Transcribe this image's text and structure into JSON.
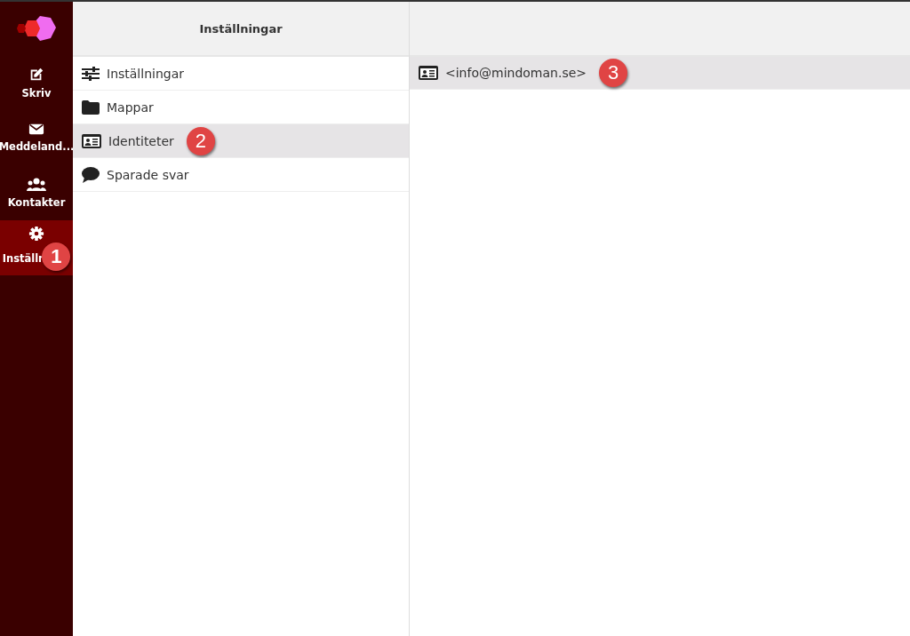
{
  "nav": [
    {
      "label": "Skriv",
      "selected": false
    },
    {
      "label": "Meddeland...",
      "selected": false
    },
    {
      "label": "Kontakter",
      "selected": false
    },
    {
      "label": "Inställn",
      "selected": true,
      "callout": "1"
    }
  ],
  "settings_panel": {
    "title": "Inställningar",
    "items": [
      {
        "label": "Inställningar",
        "selected": false
      },
      {
        "label": "Mappar",
        "selected": false
      },
      {
        "label": "Identiteter",
        "selected": true,
        "callout": "2"
      },
      {
        "label": "Sparade svar",
        "selected": false
      }
    ]
  },
  "identities": [
    {
      "label": "<info@mindoman.se>",
      "selected": true,
      "callout": "3"
    }
  ]
}
